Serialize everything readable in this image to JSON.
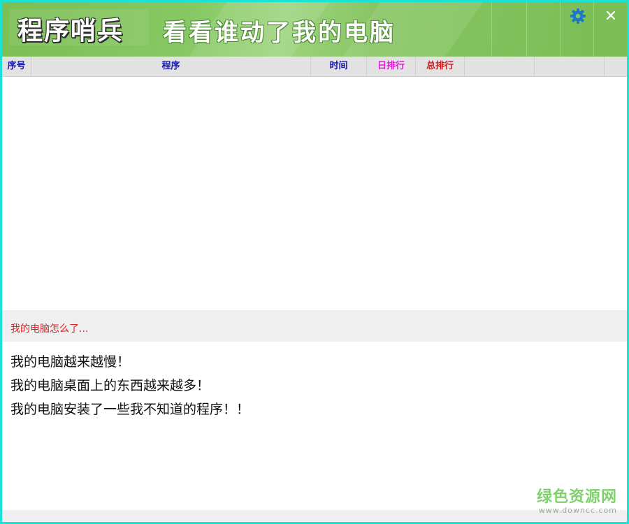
{
  "header": {
    "app_title": "程序哨兵",
    "slogan": "看看谁动了我的电脑"
  },
  "icons": {
    "settings": "gear-icon",
    "close": "close-icon"
  },
  "table": {
    "columns": [
      {
        "label": "序号",
        "color": "#1a1aa8"
      },
      {
        "label": "程序",
        "color": "#1a1aa8"
      },
      {
        "label": "时间",
        "color": "#1a1aa8"
      },
      {
        "label": "日排行",
        "color": "#e020d8"
      },
      {
        "label": "总排行",
        "color": "#d21e1e"
      },
      {
        "label": ""
      },
      {
        "label": ""
      },
      {
        "label": ""
      }
    ],
    "rows": []
  },
  "info": {
    "title": "我的电脑怎么了...",
    "messages": [
      "我的电脑越来越慢！",
      "我的电脑桌面上的东西越来越多！",
      "我的电脑安装了一些我不知道的程序！！"
    ]
  },
  "watermark": {
    "text": "绿色资源网",
    "url": "www.downcc.com"
  },
  "colors": {
    "border": "#19e3d6",
    "header_green": "#86c863",
    "accent_red": "#e02020"
  }
}
